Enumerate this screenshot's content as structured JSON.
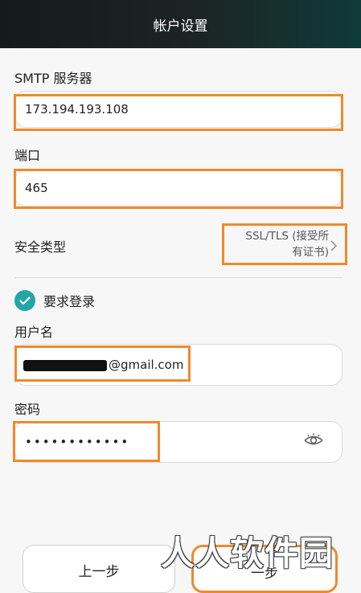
{
  "header": {
    "title": "帐户设置"
  },
  "smtp": {
    "label": "SMTP 服务器",
    "value": "173.194.193.108"
  },
  "port": {
    "label": "端口",
    "value": "465"
  },
  "security": {
    "label": "安全类型",
    "value_line1": "SSL/TLS (接受所",
    "value_line2": "有证书)",
    "chevron_icon": "chevron-right-icon"
  },
  "require_login": {
    "label": "要求登录",
    "checked": true,
    "accent": "#25a5a6"
  },
  "username": {
    "label": "用户名",
    "suffix": "@gmail.com"
  },
  "password": {
    "label": "密码",
    "masked_value": "••••••••••••",
    "toggle_icon": "eye-icon"
  },
  "buttons": {
    "previous": "上一步",
    "next": "一步"
  },
  "watermark": {
    "text": "人人软件园"
  },
  "colors": {
    "highlight": "#ef8a2a",
    "accent": "#25a5a6"
  }
}
